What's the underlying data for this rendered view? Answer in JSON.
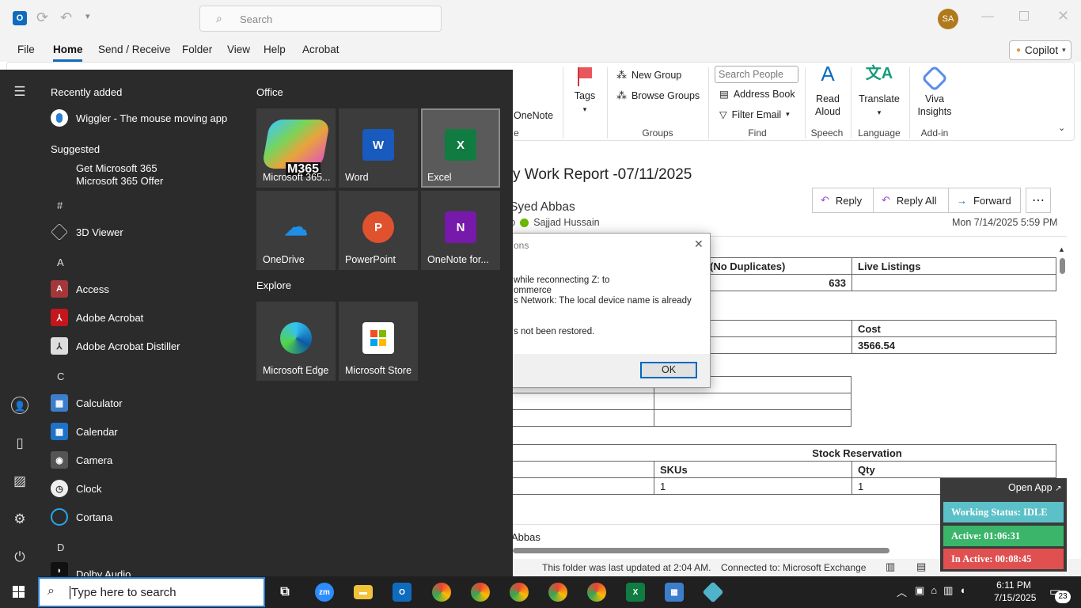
{
  "titlebar": {
    "search_placeholder": "Search",
    "avatar_initials": "SA"
  },
  "menubar": {
    "items": [
      "File",
      "Home",
      "Send / Receive",
      "Folder",
      "View",
      "Help",
      "Acrobat"
    ],
    "copilot": "Copilot"
  },
  "ribbon": {
    "onenote": "OneNote",
    "tags": "Tags",
    "new_group": "New Group",
    "browse_groups": "Browse Groups",
    "groups_label": "Groups",
    "search_people_placeholder": "Search People",
    "address_book": "Address Book",
    "filter_email": "Filter Email",
    "find_label": "Find",
    "read_aloud_1": "Read",
    "read_aloud_2": "Aloud",
    "speech_label": "Speech",
    "translate": "Translate",
    "language_label": "Language",
    "viva_1": "Viva",
    "viva_2": "Insights",
    "addin_label": "Add-in"
  },
  "message": {
    "subject": "y Work Report -07/11/2025",
    "sender": "Syed Abbas",
    "to_prefix": "To",
    "recipient": "Sajjad Hussain",
    "date": "Mon 7/14/2025 5:59 PM",
    "reply": "Reply",
    "reply_all": "Reply All",
    "forward": "Forward",
    "t1": {
      "h1": "(No Duplicates)",
      "h2": "Live Listings",
      "v1": "633",
      "v2": ""
    },
    "t2": {
      "h1": "Cost",
      "v1": "3566.54"
    },
    "t4": {
      "title": "Stock Reservation",
      "h1": "SKUs",
      "h2": "Qty",
      "v1": "1",
      "v2": "1"
    },
    "signature": "Abbas"
  },
  "dialog": {
    "title": "ons",
    "line1": "while reconnecting Z: to",
    "line2": "ommerce",
    "line3": "s Network: The local device name is already",
    "line4": "s not been restored.",
    "ok": "OK"
  },
  "statusbar": {
    "updated": "This folder was last updated at 2:04 AM.",
    "connected": "Connected to: Microsoft Exchange"
  },
  "startmenu": {
    "recently_added": "Recently added",
    "wiggler": "Wiggler - The mouse moving app",
    "suggested": "Suggested",
    "m365_line1": "Get Microsoft 365",
    "m365_line2": "Microsoft 365 Offer",
    "letters": [
      "#",
      "A",
      "C",
      "D"
    ],
    "apps": [
      "3D Viewer",
      "Access",
      "Adobe Acrobat",
      "Adobe Acrobat Distiller",
      "Calculator",
      "Calendar",
      "Camera",
      "Clock",
      "Cortana",
      "Dolby Audio"
    ],
    "office_header": "Office",
    "explore_header": "Explore",
    "tiles": [
      "Microsoft 365...",
      "Word",
      "Excel",
      "OneDrive",
      "PowerPoint",
      "OneNote for...",
      "Microsoft Edge",
      "Microsoft Store"
    ],
    "m365_badge": "M365"
  },
  "taskbar": {
    "search_placeholder": "Type here to search",
    "time": "6:11 PM",
    "date": "7/15/2025",
    "notif_count": "23"
  },
  "widget": {
    "open_app": "Open App",
    "status": "Working Status: IDLE",
    "active": "Active: 01:06:31",
    "inactive": "In Active: 00:08:45"
  },
  "colors": {
    "accent": "#0f6cbd",
    "widget_idle": "#5bc0c8",
    "widget_active": "#3ab56a",
    "widget_inactive": "#e05050"
  }
}
